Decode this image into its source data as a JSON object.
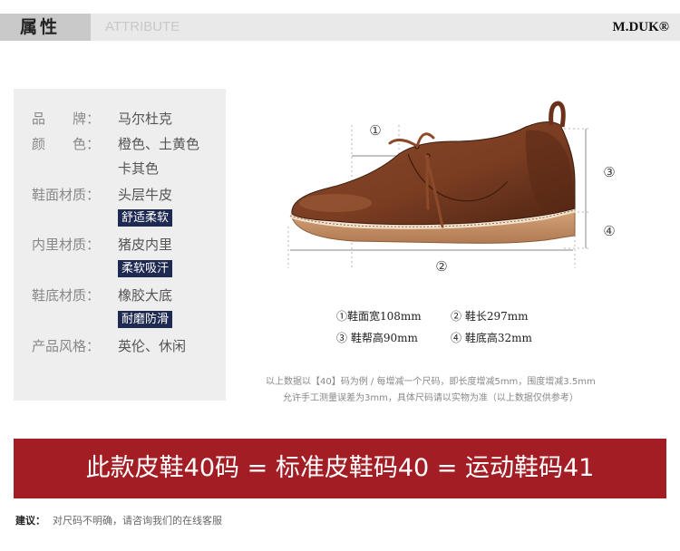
{
  "header": {
    "title": "属性",
    "subtitle": "ATTRIBUTE",
    "logo": "M.DUK®"
  },
  "attributes": [
    {
      "label": "品　　牌：",
      "value": "马尔杜克"
    },
    {
      "label": "颜　　色：",
      "value": "橙色、土黄色",
      "value2": "卡其色"
    },
    {
      "label": "鞋面材质：",
      "value": "头层牛皮",
      "tag": "舒适柔软"
    },
    {
      "label": "内里材质：",
      "value": "猪皮内里",
      "tag": "柔软吸汗"
    },
    {
      "label": "鞋底材质：",
      "value": "橡胶大底",
      "tag": "耐磨防滑"
    },
    {
      "label": "产品风格：",
      "value": "英伦、休闲"
    }
  ],
  "diagram": {
    "markers": {
      "m1": "①",
      "m2": "②",
      "m3": "③",
      "m4": "④"
    },
    "colors": {
      "leather": "#7a3d22",
      "leather_dark": "#4e2412",
      "sole": "#c8946a",
      "welt": "#f1e2cf"
    }
  },
  "measurements": [
    "①鞋面宽108mm",
    "② 鞋长297mm",
    "③ 鞋帮高90mm",
    "④ 鞋底高32mm"
  ],
  "notes": [
    "以上数据以【40】码为例 / 每增减一个尺码，即长度增减5mm，围度增减3.5mm",
    "允许手工测量误差为3mm，具体尺码请以实物为准（以上数据仅供参考）"
  ],
  "banner": {
    "text": "此款皮鞋40码 = 标准皮鞋码40 = 运动鞋码41",
    "color": "#a31d25"
  },
  "advice": {
    "label": "建议：",
    "text": "对尺码不明确，请咨询我们的在线客服"
  }
}
